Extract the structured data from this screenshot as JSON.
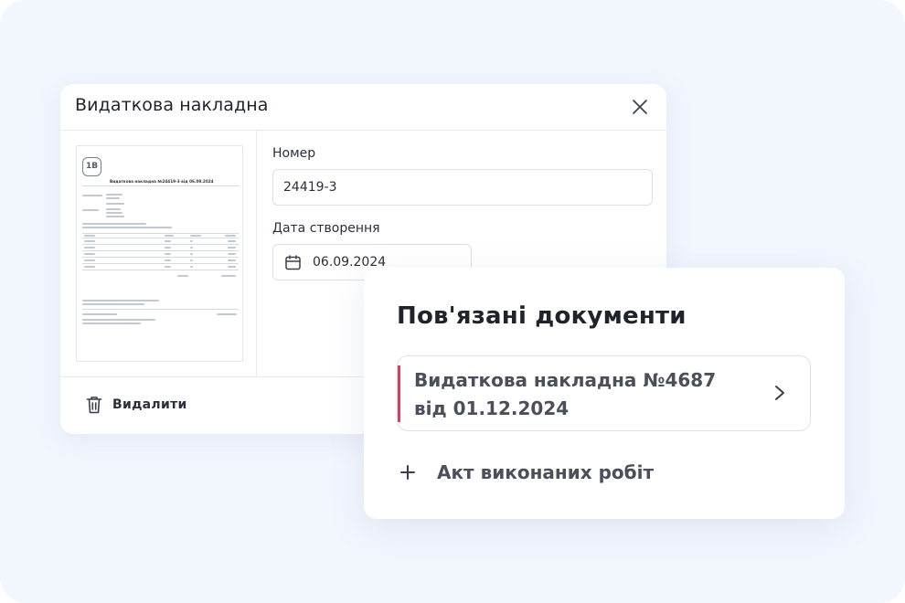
{
  "dialog": {
    "title": "Видаткова накладна",
    "close_icon": "close-icon",
    "preview": {
      "logo_text": "1B",
      "doc_title": "Видаткова накладна №24419-3 від 06.09.2024"
    },
    "number": {
      "label": "Номер",
      "value": "24419-3"
    },
    "created_date": {
      "label": "Дата створення",
      "value": "06.09.2024",
      "icon": "calendar-icon"
    },
    "footer": {
      "delete_label": "Видалити",
      "delete_icon": "trash-icon"
    }
  },
  "related": {
    "title": "Пов'язані документи",
    "items": [
      {
        "line1": "Видаткова накладна №4687",
        "line2": "від 01.12.2024",
        "accent_color": "#d6405d",
        "icon": "chevron-right-icon"
      }
    ],
    "add_label": "Акт виконаних робіт",
    "add_icon": "plus-icon"
  }
}
